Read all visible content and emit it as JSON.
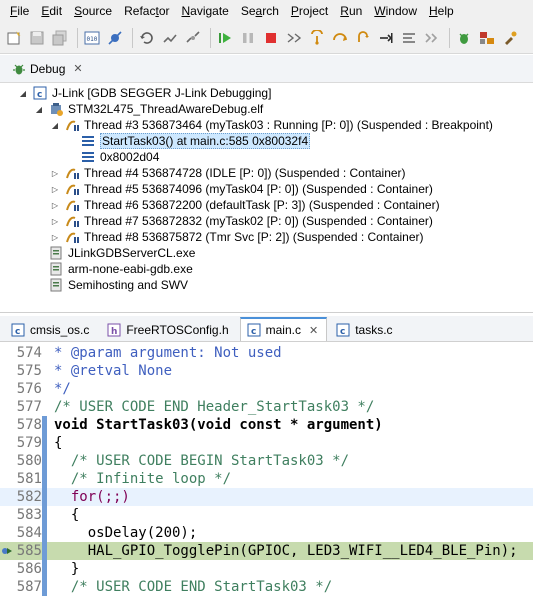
{
  "menubar": {
    "items": [
      {
        "accel": "F",
        "rest": "ile"
      },
      {
        "accel": "E",
        "rest": "dit"
      },
      {
        "accel": "S",
        "rest": "ource"
      },
      {
        "pre": "Refac",
        "accel": "t",
        "rest": "or"
      },
      {
        "accel": "N",
        "rest": "avigate"
      },
      {
        "pre": "Se",
        "accel": "a",
        "rest": "rch"
      },
      {
        "accel": "P",
        "rest": "roject"
      },
      {
        "accel": "R",
        "rest": "un"
      },
      {
        "accel": "W",
        "rest": "indow"
      },
      {
        "accel": "H",
        "rest": "elp"
      }
    ]
  },
  "debug_view": {
    "tab_label": "Debug",
    "tree": [
      {
        "label": "J-Link [GDB SEGGER J-Link Debugging]",
        "icon": "launch-icon"
      },
      {
        "label": "STM32L475_ThreadAwareDebug.elf",
        "icon": "debug-target-icon"
      },
      {
        "label": "Thread #3 536873464 (myTask03 : Running [P: 0]) (Suspended : Breakpoint)",
        "icon": "thread-icon"
      },
      {
        "label": "StartTask03() at main.c:585 0x80032f4",
        "icon": "stack-frame-icon"
      },
      {
        "label": "0x8002d04",
        "icon": "stack-frame-icon"
      },
      {
        "label": "Thread #4 536874728 (IDLE [P: 0]) (Suspended : Container)",
        "icon": "thread-icon"
      },
      {
        "label": "Thread #5 536874096 (myTask04 [P: 0]) (Suspended : Container)",
        "icon": "thread-icon"
      },
      {
        "label": "Thread #6 536872200 (defaultTask [P: 3]) (Suspended : Container)",
        "icon": "thread-icon"
      },
      {
        "label": "Thread #7 536872832 (myTask02 [P: 0]) (Suspended : Container)",
        "icon": "thread-icon"
      },
      {
        "label": "Thread #8 536875872 (Tmr Svc [P: 2]) (Suspended : Container)",
        "icon": "thread-icon"
      },
      {
        "label": "JLinkGDBServerCL.exe",
        "icon": "process-icon"
      },
      {
        "label": "arm-none-eabi-gdb.exe",
        "icon": "process-icon"
      },
      {
        "label": "Semihosting and SWV",
        "icon": "process-icon"
      }
    ]
  },
  "editor": {
    "tabs": [
      {
        "label": "cmsis_os.c"
      },
      {
        "label": "FreeRTOSConfig.h"
      },
      {
        "label": "main.c"
      },
      {
        "label": "tasks.c"
      }
    ],
    "lines": [
      {
        "num": "574",
        "text": "* @param argument: Not used"
      },
      {
        "num": "575",
        "text": "* @retval None"
      },
      {
        "num": "576",
        "text": "*/"
      },
      {
        "num": "577",
        "text": "/* USER CODE END Header_StartTask03 */"
      },
      {
        "num": "578",
        "text": "void StartTask03(void const * argument)"
      },
      {
        "num": "579",
        "text": "{"
      },
      {
        "num": "580",
        "text": "  /* USER CODE BEGIN StartTask03 */"
      },
      {
        "num": "581",
        "text": "  /* Infinite loop */"
      },
      {
        "num": "582",
        "text": "  for(;;)"
      },
      {
        "num": "583",
        "text": "  {"
      },
      {
        "num": "584",
        "text": "    osDelay(200);"
      },
      {
        "num": "585",
        "text": "    HAL_GPIO_TogglePin(GPIOC, LED3_WIFI__LED4_BLE_Pin);"
      },
      {
        "num": "586",
        "text": "  }"
      },
      {
        "num": "587",
        "text": "  /* USER CODE END StartTask03 */"
      }
    ]
  }
}
